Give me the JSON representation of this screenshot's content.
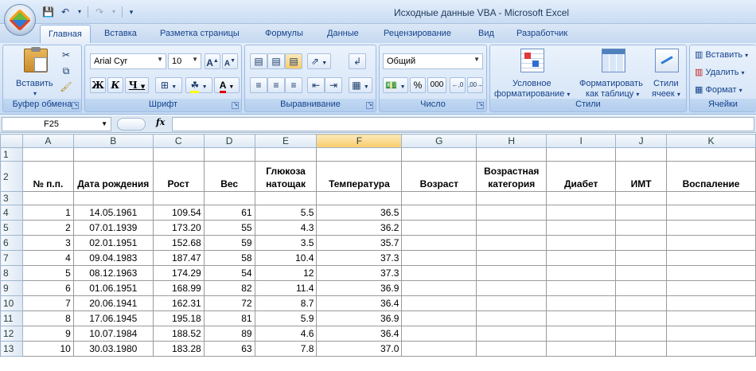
{
  "window": {
    "title": "Исходные данные VBA - Microsoft Excel"
  },
  "tabs": [
    {
      "label": "Главная",
      "active": true
    },
    {
      "label": "Вставка"
    },
    {
      "label": "Разметка страницы"
    },
    {
      "label": "Формулы"
    },
    {
      "label": "Данные"
    },
    {
      "label": "Рецензирование"
    },
    {
      "label": "Вид"
    },
    {
      "label": "Разработчик"
    }
  ],
  "ribbon": {
    "clipboard": {
      "label": "Буфер обмена",
      "paste": "Вставить"
    },
    "font": {
      "label": "Шрифт",
      "name": "Arial Cyr",
      "size": "10"
    },
    "alignment": {
      "label": "Выравнивание"
    },
    "number": {
      "label": "Число",
      "format": "Общий"
    },
    "styles": {
      "label": "Стили",
      "conditional": "Условное",
      "conditional2": "форматирование",
      "table": "Форматировать",
      "table2": "как таблицу",
      "cell": "Стили",
      "cell2": "ячеек"
    },
    "cells": {
      "label": "Ячейки",
      "insert": "Вставить",
      "delete": "Удалить",
      "format": "Формат"
    }
  },
  "formula_bar": {
    "name_box": "F25",
    "formula": ""
  },
  "sheet": {
    "columns": [
      "A",
      "B",
      "C",
      "D",
      "E",
      "F",
      "G",
      "H",
      "I",
      "J",
      "K"
    ],
    "selected_column": "F",
    "headers": [
      "№ п.п.",
      "Дата рождения",
      "Рост",
      "Вес",
      "Глюкоза натощак",
      "Температура",
      "Возраст",
      "Возрастная категория",
      "Диабет",
      "ИМТ",
      "Воспаление"
    ],
    "rows": [
      [
        "1",
        "14.05.1961",
        "109.54",
        "61",
        "5.5",
        "36.5"
      ],
      [
        "2",
        "07.01.1939",
        "173.20",
        "55",
        "4.3",
        "36.2"
      ],
      [
        "3",
        "02.01.1951",
        "152.68",
        "59",
        "3.5",
        "35.7"
      ],
      [
        "4",
        "09.04.1983",
        "187.47",
        "58",
        "10.4",
        "37.3"
      ],
      [
        "5",
        "08.12.1963",
        "174.29",
        "54",
        "12",
        "37.3"
      ],
      [
        "6",
        "01.06.1951",
        "168.99",
        "82",
        "11.4",
        "36.9"
      ],
      [
        "7",
        "20.06.1941",
        "162.31",
        "72",
        "8.7",
        "36.4"
      ],
      [
        "8",
        "17.06.1945",
        "195.18",
        "81",
        "5.9",
        "36.9"
      ],
      [
        "9",
        "10.07.1984",
        "188.52",
        "89",
        "4.6",
        "36.4"
      ],
      [
        "10",
        "30.03.1980",
        "183.28",
        "63",
        "7.8",
        "37.0"
      ]
    ],
    "row_numbers": [
      "1",
      "2",
      "3",
      "4",
      "5",
      "6",
      "7",
      "8",
      "9",
      "10",
      "11",
      "12",
      "13"
    ]
  }
}
